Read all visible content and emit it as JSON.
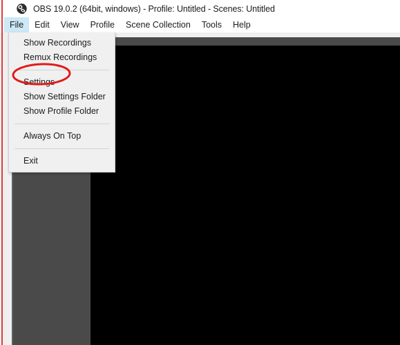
{
  "window": {
    "title": "OBS 19.0.2 (64bit, windows) - Profile: Untitled - Scenes: Untitled",
    "app_name": "OBS",
    "version": "19.0.2",
    "logo_icon": "obs-logo-icon"
  },
  "menubar": {
    "items": [
      {
        "label": "File",
        "active": true
      },
      {
        "label": "Edit",
        "active": false
      },
      {
        "label": "View",
        "active": false
      },
      {
        "label": "Profile",
        "active": false
      },
      {
        "label": "Scene Collection",
        "active": false
      },
      {
        "label": "Tools",
        "active": false
      },
      {
        "label": "Help",
        "active": false
      }
    ]
  },
  "file_menu": {
    "open": true,
    "entries": [
      {
        "label": "Show Recordings",
        "type": "item"
      },
      {
        "label": "Remux Recordings",
        "type": "item"
      },
      {
        "type": "separator"
      },
      {
        "label": "Settings",
        "type": "item",
        "highlighted": true
      },
      {
        "label": "Show Settings Folder",
        "type": "item"
      },
      {
        "label": "Show Profile Folder",
        "type": "item"
      },
      {
        "type": "separator"
      },
      {
        "label": "Always On Top",
        "type": "item"
      },
      {
        "type": "separator"
      },
      {
        "label": "Exit",
        "type": "item"
      }
    ]
  },
  "annotation": {
    "shape": "ellipse",
    "target": "Settings",
    "color": "#e01b1b",
    "stroke_width": 3
  },
  "colors": {
    "accent_highlight": "#cde8f6",
    "menu_background": "#f0f0f0",
    "preview_background": "#000000",
    "panel_gray": "#4a4a4a",
    "annotation_red": "#e01b1b"
  }
}
